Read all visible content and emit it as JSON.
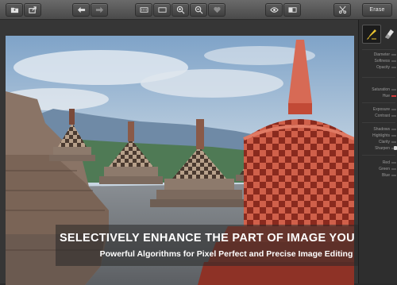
{
  "toolbar": {
    "erase_label": "Erase",
    "buttons": [
      {
        "name": "open-folder-button",
        "icon": "folder-icon"
      },
      {
        "name": "export-button",
        "icon": "export-icon"
      },
      {
        "name": "undo-button",
        "icon": "undo-icon"
      },
      {
        "name": "redo-button",
        "icon": "redo-icon"
      },
      {
        "name": "actual-size-button",
        "icon": "actual-size-icon"
      },
      {
        "name": "fit-screen-button",
        "icon": "fit-screen-icon"
      },
      {
        "name": "zoom-in-button",
        "icon": "zoom-in-icon"
      },
      {
        "name": "zoom-out-button",
        "icon": "zoom-out-icon"
      },
      {
        "name": "mask-button",
        "icon": "heart-mask-icon"
      },
      {
        "name": "preview-button",
        "icon": "eye-icon"
      },
      {
        "name": "compare-button",
        "icon": "compare-icon"
      },
      {
        "name": "clear-button",
        "icon": "scissors-icon"
      }
    ]
  },
  "caption": {
    "title": "SELECTIVELY ENHANCE THE PART OF IMAGE YOU WANT",
    "subtitle": "Powerful Algorithms for Pixel Perfect and Precise Image Editing"
  },
  "panel": {
    "tools": [
      {
        "name": "brush-tool",
        "icon": "brush-icon",
        "active": true
      },
      {
        "name": "eraser-tool",
        "icon": "eraser-icon",
        "active": false
      }
    ],
    "sliders": [
      {
        "label": "Diameter",
        "value": 0.5,
        "group": 1
      },
      {
        "label": "Softness",
        "value": 0.5,
        "group": 1
      },
      {
        "label": "Opacity",
        "value": 0.5,
        "group": 1
      },
      {
        "label": "Saturation",
        "value": 0.5,
        "group": 2
      },
      {
        "label": "Hue",
        "value": 0.5,
        "group": 2,
        "color": "#d23a3a"
      },
      {
        "label": "Exposure",
        "value": 0.5,
        "group": 3
      },
      {
        "label": "Contrast",
        "value": 0.5,
        "group": 3
      },
      {
        "label": "Shadows",
        "value": 0.5,
        "group": 4
      },
      {
        "label": "Highlights",
        "value": 0.5,
        "group": 4
      },
      {
        "label": "Clarity",
        "value": 0.5,
        "group": 4
      },
      {
        "label": "Sharpen",
        "value": 0.5,
        "group": 4
      },
      {
        "label": "Red",
        "value": 0.5,
        "group": 5
      },
      {
        "label": "Green",
        "value": 0.5,
        "group": 5
      },
      {
        "label": "Blue",
        "value": 0.5,
        "group": 5
      }
    ]
  },
  "colors": {
    "highlight_tint": "#d8402e",
    "tool_active": "#e8c230"
  }
}
